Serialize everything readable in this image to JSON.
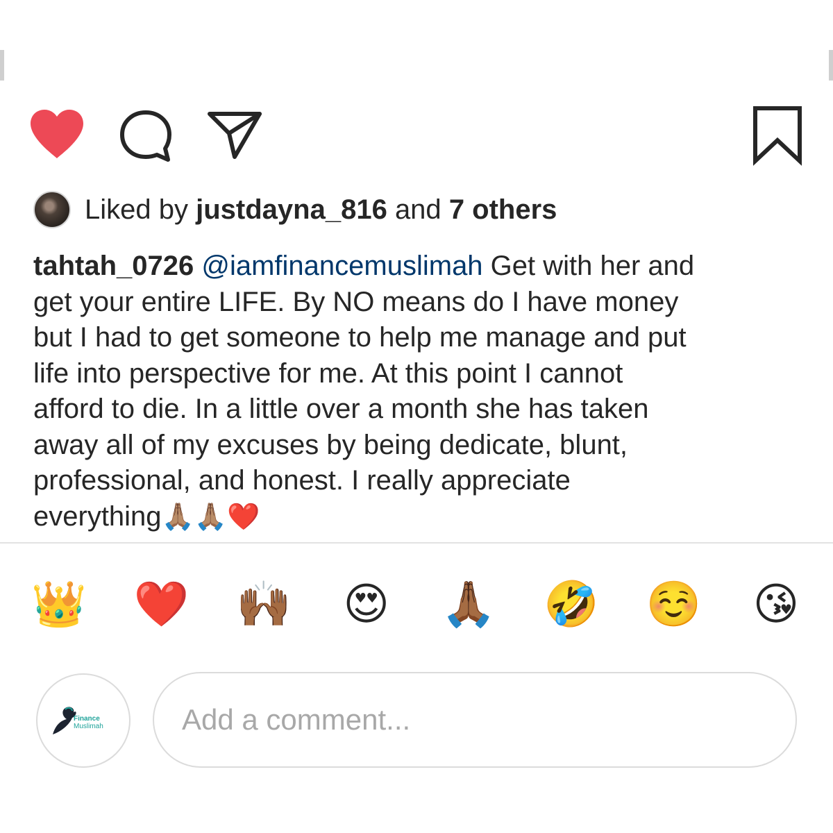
{
  "action_bar": {
    "icons": {
      "like": "heart-filled-icon",
      "comment": "speech-bubble-icon",
      "share": "paper-plane-icon",
      "save": "bookmark-icon"
    },
    "like_color": "#ed4956"
  },
  "likes": {
    "prefix": "Liked by",
    "user": "justdayna_816",
    "conjunction": "and",
    "others": "7 others"
  },
  "caption": {
    "username": "tahtah_0726",
    "mention": "@iamfinancemuslimah",
    "text": " Get with her and\nget your entire LIFE. By NO means do I have money\nbut I had to get someone to help me manage and put\nlife into perspective for me. At this point I cannot\nafford to die. In a little over a month she has taken\naway all of my excuses by being  dedicate, blunt,\nprofessional, and honest. I really appreciate\neverything",
    "emojis": "🙏🏽🙏🏽❤️"
  },
  "quick_reactions": [
    "👑",
    "❤️",
    "🙌🏾",
    "😍",
    "🙏🏾",
    "🤣",
    "☺️",
    "😘"
  ],
  "comment_box": {
    "placeholder": "Add a comment...",
    "avatar_logo_line1": "Finance",
    "avatar_logo_line2": "Muslimah"
  },
  "colors": {
    "mention": "#00376b",
    "text": "#262626",
    "logo_teal": "#1fa39a"
  }
}
